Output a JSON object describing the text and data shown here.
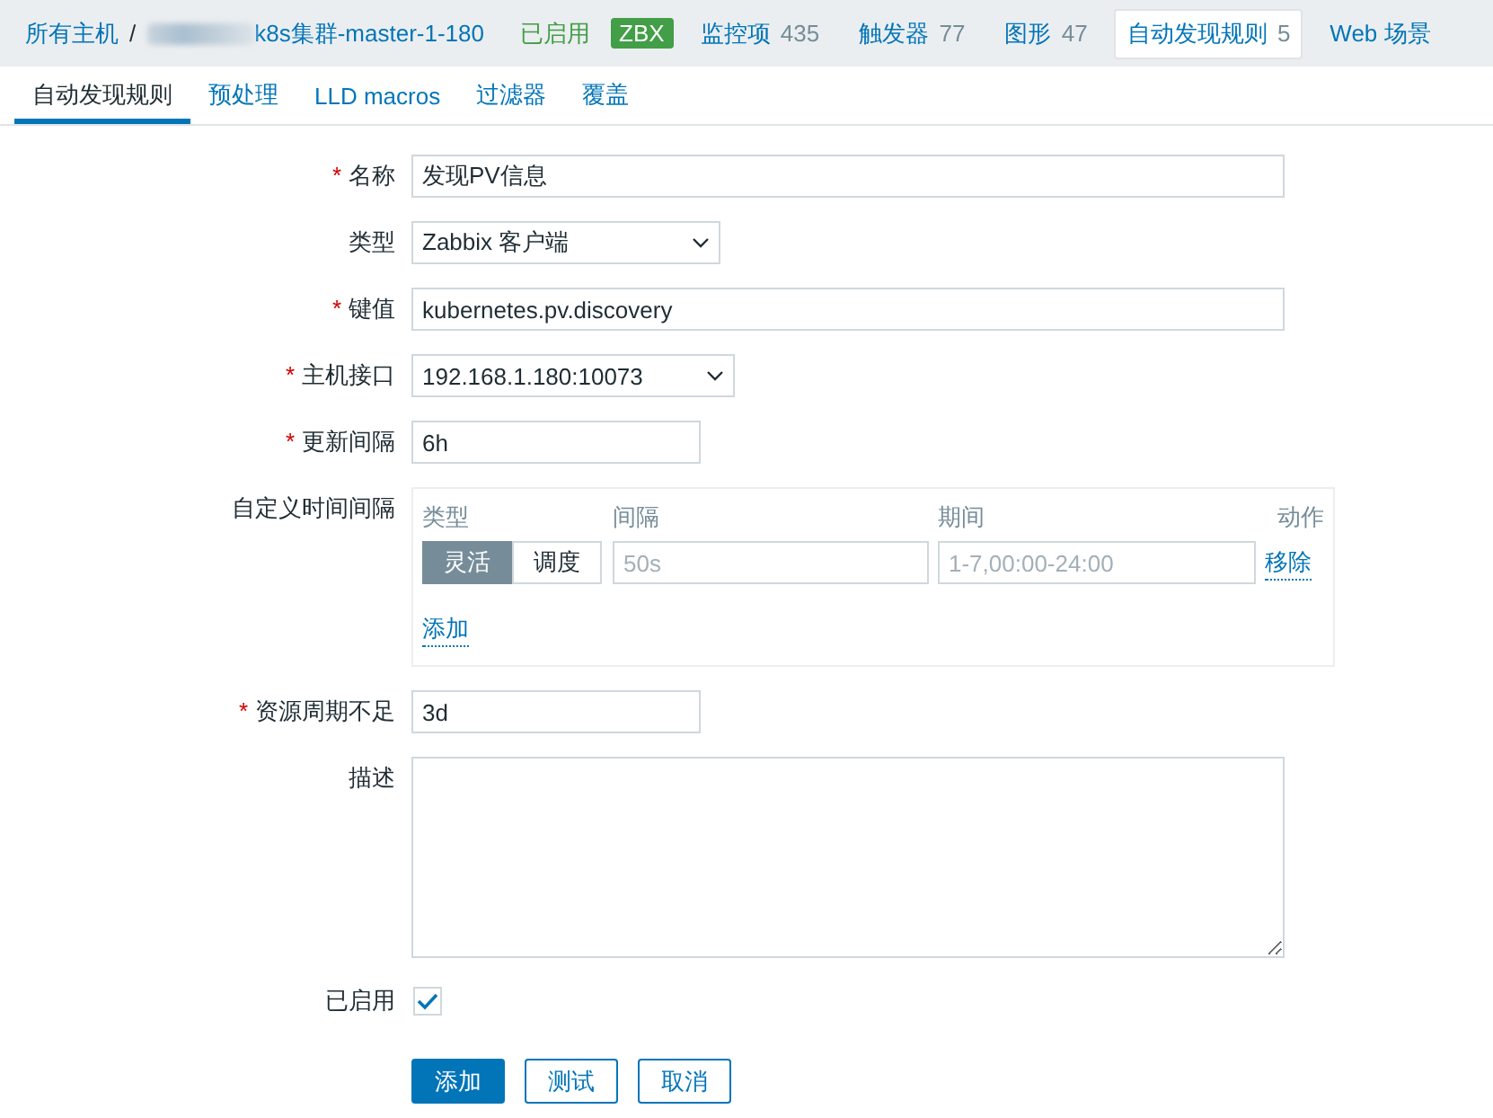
{
  "breadcrumb": {
    "root": "所有主机",
    "separator": "/",
    "host": "k8s集群-master-1-180",
    "status": "已启用",
    "badge": "ZBX"
  },
  "host_tabs": [
    {
      "label": "监控项",
      "count": "435",
      "selected": false
    },
    {
      "label": "触发器",
      "count": "77",
      "selected": false
    },
    {
      "label": "图形",
      "count": "47",
      "selected": false
    },
    {
      "label": "自动发现规则",
      "count": "5",
      "selected": true
    },
    {
      "label": "Web 场景",
      "selected": false
    }
  ],
  "tabs": [
    {
      "label": "自动发现规则",
      "selected": true
    },
    {
      "label": "预处理",
      "selected": false
    },
    {
      "label": "LLD macros",
      "selected": false
    },
    {
      "label": "过滤器",
      "selected": false
    },
    {
      "label": "覆盖",
      "selected": false
    }
  ],
  "form": {
    "fields": [
      {
        "kind": "wide-text",
        "required_mark": "*",
        "label": "名称",
        "value": "发现PV信息"
      },
      {
        "kind": "select",
        "label": "类型",
        "value": "Zabbix 客户端"
      },
      {
        "kind": "wide-text",
        "required_mark": "*",
        "label": "键值",
        "value": "kubernetes.pv.discovery"
      },
      {
        "kind": "select",
        "required_mark": "*",
        "label": "主机接口",
        "value": "192.168.1.180:10073"
      },
      {
        "kind": "short-text",
        "required_mark": "*",
        "label": "更新间隔",
        "value": "6h"
      },
      {
        "kind": "intervals",
        "label": "自定义时间间隔",
        "columns": [
          "类型",
          "间隔",
          "期间",
          "动作"
        ],
        "rows": [
          {
            "modes": [
              {
                "label": "灵活",
                "selected": true
              },
              {
                "label": "调度",
                "selected": false
              }
            ],
            "interval_placeholder": "50s",
            "period_placeholder": "1-7,00:00-24:00",
            "remove": "移除"
          }
        ],
        "add": "添加"
      },
      {
        "kind": "short-text",
        "required_mark": "*",
        "label": "资源周期不足",
        "value": "3d"
      },
      {
        "kind": "textarea",
        "label": "描述"
      },
      {
        "kind": "checkbox",
        "label": "已启用",
        "checked": true
      }
    ],
    "buttons": [
      {
        "label": "添加",
        "primary": true
      },
      {
        "label": "测试",
        "primary": false
      },
      {
        "label": "取消",
        "primary": false
      }
    ]
  }
}
